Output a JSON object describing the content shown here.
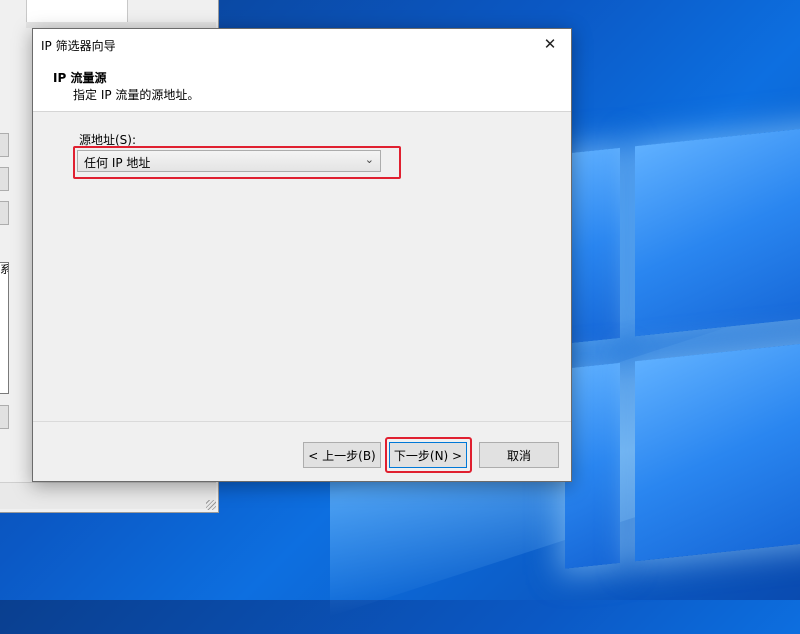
{
  "background_parent": {
    "partial_text": "系"
  },
  "dialog": {
    "title": "IP 筛选器向导",
    "close_glyph": "✕",
    "header_title": "IP 流量源",
    "header_subtitle": "指定 IP 流量的源地址。",
    "source_label": "源地址(S):",
    "source_value": "任何 IP 地址",
    "dropdown_chevron": "⌄",
    "back_button": "< 上一步(B)",
    "next_button": "下一步(N) >",
    "cancel_button": "取消"
  },
  "highlights": {
    "color": "#e02030"
  }
}
